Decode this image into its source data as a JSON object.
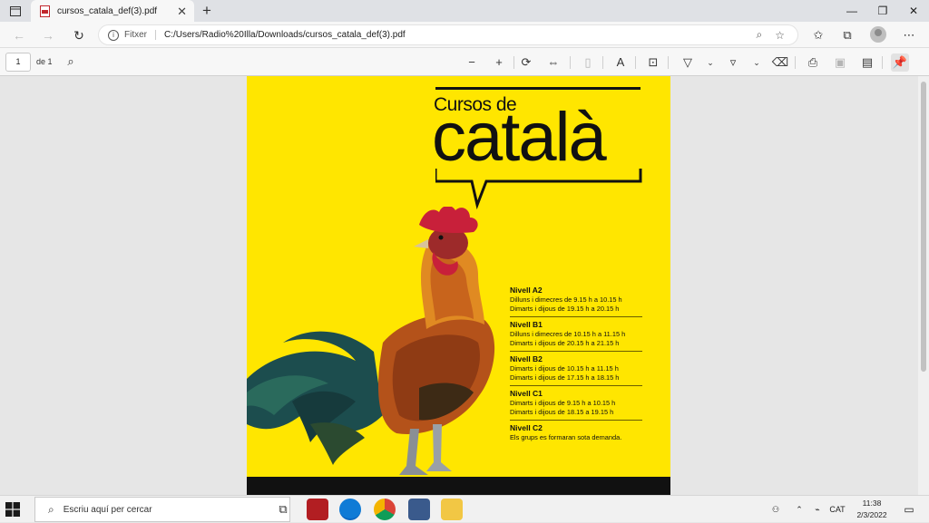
{
  "browser": {
    "tab_title": "cursos_catala_def(3).pdf",
    "new_tab_symbol": "+",
    "address_scheme": "Fitxer",
    "url": "C:/Users/Radio%20Illa/Downloads/cursos_catala_def(3).pdf",
    "window_controls": [
      "minimize-icon",
      "restore-icon",
      "close-icon"
    ]
  },
  "pdf_toolbar": {
    "page_number": "1",
    "page_of": "de 1"
  },
  "document": {
    "headline_small": "Cursos de",
    "headline_big": "català",
    "courses": [
      {
        "level": "Nivell A2",
        "lines": [
          "Dilluns i dimecres de 9.15 h a 10.15 h",
          "Dimarts i dijous de 19.15 h a 20.15 h"
        ]
      },
      {
        "level": "Nivell B1",
        "lines": [
          "Dilluns i dimecres de 10.15 h a 11.15 h",
          "Dimarts i dijous de 20.15 h a 21.15 h"
        ]
      },
      {
        "level": "Nivell B2",
        "lines": [
          "Dimarts i dijous de 10.15 h a 11.15 h",
          "Dimarts i dijous de 17.15 h a 18.15 h"
        ]
      },
      {
        "level": "Nivell C1",
        "lines": [
          "Dimarts i dijous de 9.15 h a 10.15 h",
          "Dimarts i dijous de 18.15 a 19.15 h"
        ]
      },
      {
        "level": "Nivell C2",
        "lines": [
          "Els grups es formaran sota demanda."
        ]
      }
    ]
  },
  "taskbar": {
    "search_placeholder": "Escriu aquí per cercar",
    "language": "CAT",
    "time": "11:38",
    "date": "2/3/2022"
  },
  "colors": {
    "poster_yellow": "#ffe600",
    "poster_black": "#111111",
    "rooster_red": "#c8203a",
    "rooster_orange": "#c8641c",
    "tail_teal": "#1c4d4e"
  }
}
